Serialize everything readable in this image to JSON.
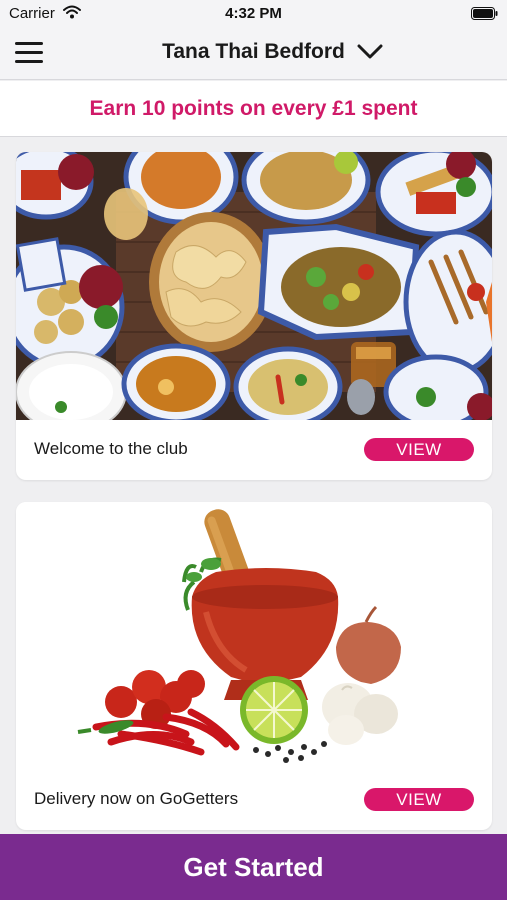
{
  "status_bar": {
    "carrier": "Carrier",
    "time": "4:32 PM"
  },
  "nav": {
    "title": "Tana Thai Bedford",
    "menu_icon": "hamburger-menu-icon",
    "dropdown_icon": "chevron-down-icon"
  },
  "promo": {
    "text": "Earn 10 points on every £1 spent"
  },
  "cards": [
    {
      "label": "Welcome to the club",
      "button": "VIEW",
      "image": "thai-food-spread"
    },
    {
      "label": "Delivery now on GoGetters",
      "button": "VIEW",
      "image": "mortar-pestle-ingredients"
    }
  ],
  "cta": {
    "label": "Get Started"
  },
  "colors": {
    "accent": "#d9176a",
    "promo_text": "#d01a68",
    "cta_bg": "#7a2b8f",
    "background": "#efeff1"
  }
}
